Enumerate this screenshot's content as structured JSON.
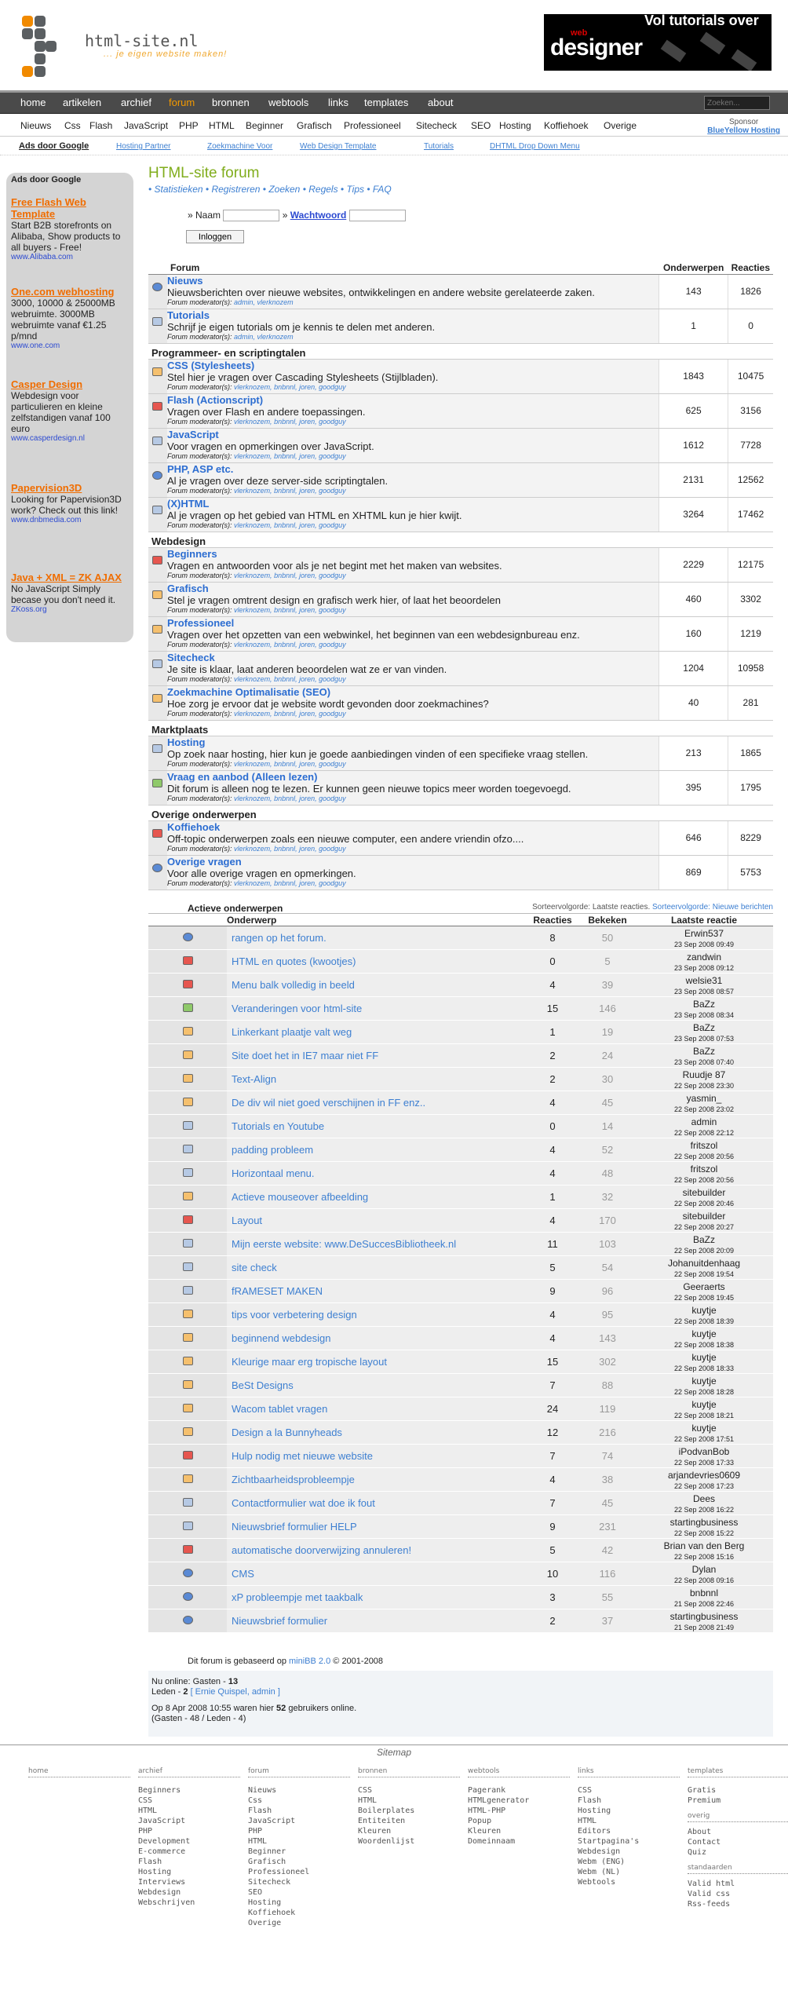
{
  "header": {
    "title": "html-site.nl",
    "tagline": "... je eigen website maken!",
    "banner_line1": "Vol tutorials over",
    "banner_line2": "designer",
    "banner_line3": "web"
  },
  "nav": {
    "items": [
      "home",
      "artikelen",
      "archief",
      "forum",
      "bronnen",
      "webtools",
      "links",
      "templates",
      "about"
    ],
    "active": "forum",
    "search_placeholder": "Zoeken..."
  },
  "subnav": {
    "items": [
      "Nieuws",
      "Css",
      "Flash",
      "JavaScript",
      "PHP",
      "HTML",
      "Beginner",
      "Grafisch",
      "Professioneel",
      "Sitecheck",
      "SEO",
      "Hosting",
      "Koffiehoek",
      "Overige"
    ],
    "sponsor_label": "Sponsor",
    "sponsor": "BlueYellow Hosting"
  },
  "adstrip": {
    "ads_by": "Ads door Google",
    "items": [
      "Hosting Partner",
      "Zoekmachine Voor",
      "Web Design Template",
      "Tutorials",
      "DHTML Drop Down Menu"
    ]
  },
  "sidebar": {
    "ads_by": "Ads door Google",
    "ads": [
      {
        "title": "Free Flash Web Template",
        "text": "Start B2B storefronts on Alibaba, Show products to all buyers - Free!",
        "url": "www.Alibaba.com"
      },
      {
        "title": "One.com webhosting",
        "text": "3000, 10000 & 25000MB webruimte. 3000MB webruimte vanaf €1.25 p/mnd",
        "url": "www.one.com"
      },
      {
        "title": "Casper Design",
        "text": "Webdesign voor particulieren en kleine zelfstandigen vanaf 100 euro",
        "url": "www.casperdesign.nl"
      },
      {
        "title": "Papervision3D",
        "text": "Looking for Papervision3D work? Check out this link!",
        "url": "www.dnbmedia.com"
      },
      {
        "title": "Java + XML = ZK AJAX",
        "text": "No JavaScript Simply becase you don't need it.",
        "url": "ZKoss.org"
      }
    ]
  },
  "forum": {
    "title": "HTML-site forum",
    "links": "• Statistieken • Registreren • Zoeken • Regels • Tips • FAQ",
    "login": {
      "name_label": "» Naam",
      "password_label": "Wachtwoord",
      "button": "Inloggen"
    },
    "col_forum": "Forum",
    "col_topics": "Onderwerpen",
    "col_replies": "Reacties",
    "mod_label": "Forum moderator(s):",
    "sections": [
      {
        "name": "",
        "forums": [
          {
            "title": "Nieuws",
            "desc": "Nieuwsberichten over nieuwe websites, ontwikkelingen en andere website gerelateerde zaken.",
            "mods": "admin, vlerknozem",
            "topics": "143",
            "replies": "1826",
            "icon": "b"
          },
          {
            "title": "Tutorials",
            "desc": "Schrijf je eigen tutorials om je kennis te delen met anderen.",
            "mods": "admin, vlerknozem",
            "topics": "1",
            "replies": "0",
            "icon": ""
          }
        ]
      },
      {
        "name": "Programmeer- en scriptingtalen",
        "forums": [
          {
            "title": "CSS (Stylesheets)",
            "desc": "Stel hier je vragen over Cascading Stylesheets (Stijlbladen).",
            "mods": "vlerknozem, bnbnnl, joren, goodguy",
            "topics": "1843",
            "replies": "10475",
            "icon": "o"
          },
          {
            "title": "Flash (Actionscript)",
            "desc": "Vragen over Flash en andere toepassingen.",
            "mods": "vlerknozem, bnbnnl, joren, goodguy",
            "topics": "625",
            "replies": "3156",
            "icon": "r"
          },
          {
            "title": "JavaScript",
            "desc": "Voor vragen en opmerkingen over JavaScript.",
            "mods": "vlerknozem, bnbnnl, joren, goodguy",
            "topics": "1612",
            "replies": "7728",
            "icon": ""
          },
          {
            "title": "PHP, ASP etc.",
            "desc": "Al je vragen over deze server-side scriptingtalen.",
            "mods": "vlerknozem, bnbnnl, joren, goodguy",
            "topics": "2131",
            "replies": "12562",
            "icon": "b"
          },
          {
            "title": "(X)HTML",
            "desc": "Al je vragen op het gebied van HTML en XHTML kun je hier kwijt.",
            "mods": "vlerknozem, bnbnnl, joren, goodguy",
            "topics": "3264",
            "replies": "17462",
            "icon": ""
          }
        ]
      },
      {
        "name": "Webdesign",
        "forums": [
          {
            "title": "Beginners",
            "desc": "Vragen en antwoorden voor als je net begint met het maken van websites.",
            "mods": "vlerknozem, bnbnnl, joren, goodguy",
            "topics": "2229",
            "replies": "12175",
            "icon": "r"
          },
          {
            "title": "Grafisch",
            "desc": "Stel je vragen omtrent design en grafisch werk hier, of laat het beoordelen",
            "mods": "vlerknozem, bnbnnl, joren, goodguy",
            "topics": "460",
            "replies": "3302",
            "icon": "o"
          },
          {
            "title": "Professioneel",
            "desc": "Vragen over het opzetten van een webwinkel, het beginnen van een webdesignbureau enz.",
            "mods": "vlerknozem, bnbnnl, joren, goodguy",
            "topics": "160",
            "replies": "1219",
            "icon": "o"
          },
          {
            "title": "Sitecheck",
            "desc": "Je site is klaar, laat anderen beoordelen wat ze er van vinden.",
            "mods": "vlerknozem, bnbnnl, joren, goodguy",
            "topics": "1204",
            "replies": "10958",
            "icon": ""
          },
          {
            "title": "Zoekmachine Optimalisatie (SEO)",
            "desc": "Hoe zorg je ervoor dat je website wordt gevonden door zoekmachines?",
            "mods": "vlerknozem, bnbnnl, joren, goodguy",
            "topics": "40",
            "replies": "281",
            "icon": "o"
          }
        ]
      },
      {
        "name": "Marktplaats",
        "forums": [
          {
            "title": "Hosting",
            "desc": "Op zoek naar hosting, hier kun je goede aanbiedingen vinden of een specifieke vraag stellen.",
            "mods": "vlerknozem, bnbnnl, joren, goodguy",
            "topics": "213",
            "replies": "1865",
            "icon": ""
          },
          {
            "title": "Vraag en aanbod (Alleen lezen)",
            "desc": "Dit forum is alleen nog te lezen. Er kunnen geen nieuwe topics meer worden toegevoegd.",
            "mods": "vlerknozem, bnbnnl, joren, goodguy",
            "topics": "395",
            "replies": "1795",
            "icon": "g"
          }
        ]
      },
      {
        "name": "Overige onderwerpen",
        "forums": [
          {
            "title": "Koffiehoek",
            "desc": "Off-topic onderwerpen zoals een nieuwe computer, een andere vriendin ofzo....",
            "mods": "vlerknozem, bnbnnl, joren, goodguy",
            "topics": "646",
            "replies": "8229",
            "icon": "r"
          },
          {
            "title": "Overige vragen",
            "desc": "Voor alle overige vragen en opmerkingen.",
            "mods": "vlerknozem, bnbnnl, joren, goodguy",
            "topics": "869",
            "replies": "5753",
            "icon": "b"
          }
        ]
      }
    ]
  },
  "active": {
    "title": "Actieve onderwerpen",
    "sort_label": "Sorteervolgorde: Laatste reacties.",
    "sort_alt": "Sorteervolgorde: Nieuwe berichten",
    "col_subject": "Onderwerp",
    "col_replies": "Reacties",
    "col_views": "Bekeken",
    "col_last": "Laatste reactie",
    "rows": [
      [
        "rangen op het forum.",
        "8",
        "50",
        "Erwin537",
        "23 Sep 2008 09:49",
        "b"
      ],
      [
        "HTML en quotes (kwootjes)",
        "0",
        "5",
        "zandwin",
        "23 Sep 2008 09:12",
        "r"
      ],
      [
        "Menu balk volledig in beeld",
        "4",
        "39",
        "welsie31",
        "23 Sep 2008 08:57",
        "r"
      ],
      [
        "Veranderingen voor html-site",
        "15",
        "146",
        "BaZz",
        "23 Sep 2008 08:34",
        "g"
      ],
      [
        "Linkerkant plaatje valt weg",
        "1",
        "19",
        "BaZz",
        "23 Sep 2008 07:53",
        "o"
      ],
      [
        "Site doet het in IE7 maar niet FF",
        "2",
        "24",
        "BaZz",
        "23 Sep 2008 07:40",
        "o"
      ],
      [
        "Text-Align",
        "2",
        "30",
        "Ruudje 87",
        "22 Sep 2008 23:30",
        "o"
      ],
      [
        "De div wil niet goed verschijnen in FF enz..",
        "4",
        "45",
        "yasmin_",
        "22 Sep 2008 23:02",
        "o"
      ],
      [
        "Tutorials en Youtube",
        "0",
        "14",
        "admin",
        "22 Sep 2008 22:12",
        ""
      ],
      [
        "padding probleem",
        "4",
        "52",
        "fritszol",
        "22 Sep 2008 20:56",
        ""
      ],
      [
        "Horizontaal menu.",
        "4",
        "48",
        "fritszol",
        "22 Sep 2008 20:56",
        ""
      ],
      [
        "Actieve mouseover afbeelding",
        "1",
        "32",
        "sitebuilder",
        "22 Sep 2008 20:46",
        "o"
      ],
      [
        "Layout",
        "4",
        "170",
        "sitebuilder",
        "22 Sep 2008 20:27",
        "r"
      ],
      [
        "Mijn eerste website: www.DeSuccesBibliotheek.nl",
        "11",
        "103",
        "BaZz",
        "22 Sep 2008 20:09",
        ""
      ],
      [
        "site check",
        "5",
        "54",
        "Johanuitdenhaag",
        "22 Sep 2008 19:54",
        ""
      ],
      [
        "fRAMESET MAKEN",
        "9",
        "96",
        "Geeraerts",
        "22 Sep 2008 19:45",
        ""
      ],
      [
        "tips voor verbetering design",
        "4",
        "95",
        "kuytje",
        "22 Sep 2008 18:39",
        "o"
      ],
      [
        "beginnend webdesign",
        "4",
        "143",
        "kuytje",
        "22 Sep 2008 18:38",
        "o"
      ],
      [
        "Kleurige maar erg tropische layout",
        "15",
        "302",
        "kuytje",
        "22 Sep 2008 18:33",
        "o"
      ],
      [
        "BeSt Designs",
        "7",
        "88",
        "kuytje",
        "22 Sep 2008 18:28",
        "o"
      ],
      [
        "Wacom tablet vragen",
        "24",
        "119",
        "kuytje",
        "22 Sep 2008 18:21",
        "o"
      ],
      [
        "Design a la Bunnyheads",
        "12",
        "216",
        "kuytje",
        "22 Sep 2008 17:51",
        "o"
      ],
      [
        "Hulp nodig met nieuwe website",
        "7",
        "74",
        "iPodvanBob",
        "22 Sep 2008 17:33",
        "r"
      ],
      [
        "Zichtbaarheidsprobleempje",
        "4",
        "38",
        "arjandevries0609",
        "22 Sep 2008 17:23",
        "o"
      ],
      [
        "Contactformulier wat doe ik fout",
        "7",
        "45",
        "Dees",
        "22 Sep 2008 16:22",
        ""
      ],
      [
        "Nieuwsbrief formulier HELP",
        "9",
        "231",
        "startingbusiness",
        "22 Sep 2008 15:22",
        ""
      ],
      [
        "automatische doorverwijzing annuleren!",
        "5",
        "42",
        "Brian van den Berg",
        "22 Sep 2008 15:16",
        "r"
      ],
      [
        "CMS",
        "10",
        "116",
        "Dylan",
        "22 Sep 2008 09:16",
        "b"
      ],
      [
        "xP probleempje met taakbalk",
        "3",
        "55",
        "bnbnnl",
        "21 Sep 2008 22:46",
        "b"
      ],
      [
        "Nieuwsbrief formulier",
        "2",
        "37",
        "startingbusiness",
        "21 Sep 2008 21:49",
        "b"
      ]
    ]
  },
  "footer": {
    "powered_pre": "Dit forum is gebaseerd op",
    "powered_link": "miniBB 2.0",
    "powered_post": "© 2001-2008",
    "online_label": "Nu online: Gasten -",
    "online_guests": "13",
    "members_label": "Leden -",
    "members_count": "2",
    "members_names": "[ Ernie Quispel, admin ]",
    "record_pre": "Op 8 Apr 2008 10:55 waren hier",
    "record_count": "52",
    "record_post": "gebruikers online.",
    "record_detail": "(Gasten - 48 / Leden - 4)"
  },
  "sitemap": {
    "title": "Sitemap",
    "columns": [
      {
        "h": "home",
        "items": []
      },
      {
        "h": "archief",
        "items": [
          "Beginners",
          "CSS",
          "HTML",
          "JavaScript",
          "PHP",
          "Development",
          "E-commerce",
          "Flash",
          "Hosting",
          "Interviews",
          "Webdesign",
          "Webschrijven"
        ]
      },
      {
        "h": "forum",
        "items": [
          "Nieuws",
          "Css",
          "Flash",
          "JavaScript",
          "PHP",
          "HTML",
          "Beginner",
          "Grafisch",
          "Professioneel",
          "Sitecheck",
          "SEO",
          "Hosting",
          "Koffiehoek",
          "Overige"
        ]
      },
      {
        "h": "bronnen",
        "items": [
          "CSS",
          "HTML",
          "Boilerplates",
          "Entiteiten",
          "Kleuren",
          "Woordenlijst"
        ]
      },
      {
        "h": "webtools",
        "items": [
          "Pagerank",
          "HTMLgenerator",
          "HTML-PHP",
          "Popup",
          "Kleuren",
          "Domeinnaam"
        ]
      },
      {
        "h": "links",
        "items": [
          "CSS",
          "Flash",
          "Hosting",
          "HTML",
          "Editors",
          "Startpagina's",
          "Webdesign",
          "Webm (ENG)",
          "Webm (NL)",
          "Webtools"
        ]
      }
    ],
    "extra": {
      "templates": "templates",
      "templates_items": [
        "Gratis",
        "Premium"
      ],
      "overig": "overig",
      "overig_items": [
        "About",
        "Contact",
        "Quiz"
      ],
      "standaarden": "standaarden",
      "standaarden_items": [
        "Valid html",
        "Valid css",
        "Rss-feeds"
      ]
    }
  }
}
